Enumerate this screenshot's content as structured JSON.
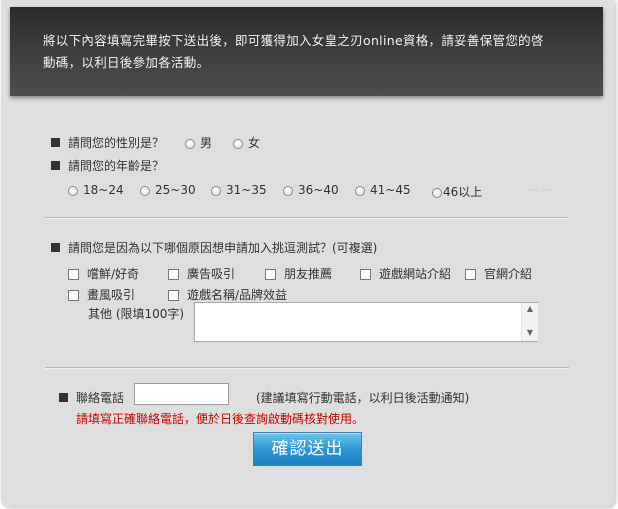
{
  "intro": {
    "line1": "將以下內容填寫完畢按下送出後，即可獲得加入女皇之刃online資格，請妥善保管您的啓",
    "line2": "動碼，以利日後參加各活動。"
  },
  "gender": {
    "question": "請問您的性別是？",
    "options": [
      "男",
      "女"
    ]
  },
  "age": {
    "question": "請問您的年齡是？",
    "options": [
      "18~24",
      "25~30",
      "31~35",
      "36~40",
      "41~45",
      "46以上"
    ]
  },
  "reason": {
    "question": "請問您是因為以下哪個原因想申請加入挑逗測試？(可複選)",
    "options": [
      "嚐鮮/好奇",
      "廣告吸引",
      "朋友推薦",
      "遊戲網站介紹",
      "官網介紹",
      "畫風吸引",
      "遊戲名稱/品牌效益"
    ],
    "other_label": "其他 (限填100字)",
    "other_value": ""
  },
  "phone": {
    "label": "聯絡電話",
    "value": "",
    "hint": "(建議填寫行動電話，以利日後活動通知)",
    "warning": "請填寫正確聯絡電話，便於日後查詢啟動碼核對使用。"
  },
  "submit_label": "確認送出",
  "colors": {
    "panel": "#dedede",
    "banner": "#333333",
    "warning": "#cc0000",
    "button": "#2d97d6"
  }
}
